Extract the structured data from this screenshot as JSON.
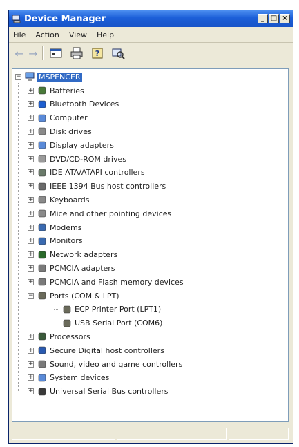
{
  "window": {
    "title": "Device Manager"
  },
  "menu": [
    "File",
    "Action",
    "View",
    "Help"
  ],
  "tree": {
    "root": "MSPENCER",
    "categories": [
      {
        "label": "Batteries",
        "icon": "battery-icon",
        "color": "#4a7a3a"
      },
      {
        "label": "Bluetooth Devices",
        "icon": "bluetooth-icon",
        "color": "#1e5fd0"
      },
      {
        "label": "Computer",
        "icon": "computer-icon",
        "color": "#5a8ad8"
      },
      {
        "label": "Disk drives",
        "icon": "disk-drive-icon",
        "color": "#8a8a8a"
      },
      {
        "label": "Display adapters",
        "icon": "display-adapter-icon",
        "color": "#5a8ad8"
      },
      {
        "label": "DVD/CD-ROM drives",
        "icon": "cdrom-icon",
        "color": "#9a9a9a"
      },
      {
        "label": "IDE ATA/ATAPI controllers",
        "icon": "ide-controller-icon",
        "color": "#6a7a6a"
      },
      {
        "label": "IEEE 1394 Bus host controllers",
        "icon": "ieee1394-icon",
        "color": "#6a6a6a"
      },
      {
        "label": "Keyboards",
        "icon": "keyboard-icon",
        "color": "#8a8a8a"
      },
      {
        "label": "Mice and other pointing devices",
        "icon": "mouse-icon",
        "color": "#8a8a8a"
      },
      {
        "label": "Modems",
        "icon": "modem-icon",
        "color": "#3a6ab0"
      },
      {
        "label": "Monitors",
        "icon": "monitor-icon",
        "color": "#3a6ab0"
      },
      {
        "label": "Network adapters",
        "icon": "network-adapter-icon",
        "color": "#2a6a2a"
      },
      {
        "label": "PCMCIA adapters",
        "icon": "pcmcia-icon",
        "color": "#7a7a7a"
      },
      {
        "label": "PCMCIA and Flash memory devices",
        "icon": "flash-memory-icon",
        "color": "#7a7a7a"
      },
      {
        "label": "Ports (COM & LPT)",
        "icon": "port-icon",
        "color": "#6a6a5a"
      },
      {
        "label": "ECP Printer Port (LPT1)",
        "icon": "port-icon",
        "color": "#6a6a5a",
        "child": true
      },
      {
        "label": "USB Serial Port (COM6)",
        "icon": "port-icon",
        "color": "#6a6a5a",
        "child": true
      },
      {
        "label": "Processors",
        "icon": "processor-icon",
        "color": "#3a5a3a"
      },
      {
        "label": "Secure Digital host controllers",
        "icon": "sd-controller-icon",
        "color": "#2a5ab0"
      },
      {
        "label": "Sound, video and game controllers",
        "icon": "sound-icon",
        "color": "#7a7a7a"
      },
      {
        "label": "System devices",
        "icon": "system-devices-icon",
        "color": "#5a8ad8"
      },
      {
        "label": "Universal Serial Bus controllers",
        "icon": "usb-icon",
        "color": "#3a3a3a"
      }
    ]
  }
}
